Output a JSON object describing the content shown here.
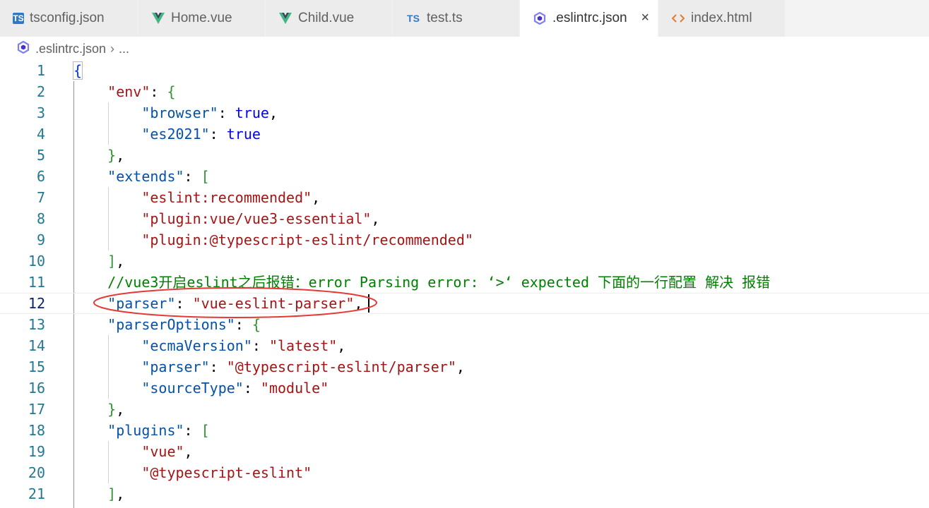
{
  "tabs": [
    {
      "label": "tsconfig.json",
      "icon": "typescript-icon",
      "active": false
    },
    {
      "label": "Home.vue",
      "icon": "vue-icon",
      "active": false
    },
    {
      "label": "Child.vue",
      "icon": "vue-icon",
      "active": false
    },
    {
      "label": "test.ts",
      "icon": "typescript-icon",
      "active": false
    },
    {
      "label": ".eslintrc.json",
      "icon": "eslint-icon",
      "active": true
    },
    {
      "label": "index.html",
      "icon": "html-icon",
      "active": false
    }
  ],
  "tab_icons": {
    "ts": "TS",
    "close": "×"
  },
  "breadcrumb": {
    "file": ".eslintrc.json",
    "separator": "›",
    "more": "..."
  },
  "colors": {
    "line_number": "#237893",
    "key": "#a31515",
    "string": "#a31515",
    "keyword": "#0000ff",
    "comment": "#008000",
    "annotation": "#e53935"
  },
  "editor": {
    "current_line": 12,
    "lines": [
      {
        "n": "1",
        "tokens": [
          [
            "br1",
            "{"
          ]
        ]
      },
      {
        "n": "2",
        "tokens": [
          [
            "sp",
            "    "
          ],
          [
            "k",
            "\"env\""
          ],
          [
            "p",
            ": "
          ],
          [
            "br2",
            "{"
          ]
        ]
      },
      {
        "n": "3",
        "tokens": [
          [
            "sp",
            "        "
          ],
          [
            "kn",
            "\"browser\""
          ],
          [
            "p",
            ": "
          ],
          [
            "b",
            "true"
          ],
          [
            "p",
            ","
          ]
        ]
      },
      {
        "n": "4",
        "tokens": [
          [
            "sp",
            "        "
          ],
          [
            "kn",
            "\"es2021\""
          ],
          [
            "p",
            ": "
          ],
          [
            "b",
            "true"
          ]
        ]
      },
      {
        "n": "5",
        "tokens": [
          [
            "sp",
            "    "
          ],
          [
            "br2",
            "}"
          ],
          [
            "p",
            ","
          ]
        ]
      },
      {
        "n": "6",
        "tokens": [
          [
            "sp",
            "    "
          ],
          [
            "kn",
            "\"extends\""
          ],
          [
            "p",
            ": "
          ],
          [
            "br2",
            "["
          ]
        ]
      },
      {
        "n": "7",
        "tokens": [
          [
            "sp",
            "        "
          ],
          [
            "s",
            "\"eslint:recommended\""
          ],
          [
            "p",
            ","
          ]
        ]
      },
      {
        "n": "8",
        "tokens": [
          [
            "sp",
            "        "
          ],
          [
            "s",
            "\"plugin:vue/vue3-essential\""
          ],
          [
            "p",
            ","
          ]
        ]
      },
      {
        "n": "9",
        "tokens": [
          [
            "sp",
            "        "
          ],
          [
            "s",
            "\"plugin:@typescript-eslint/recommended\""
          ]
        ]
      },
      {
        "n": "10",
        "tokens": [
          [
            "sp",
            "    "
          ],
          [
            "br2",
            "]"
          ],
          [
            "p",
            ","
          ]
        ]
      },
      {
        "n": "11",
        "tokens": [
          [
            "sp",
            "    "
          ],
          [
            "c",
            "//vue3开启eslint之后报错：error Parsing error: ‘>‘ expected 下面的一行配置 解决 报错"
          ]
        ]
      },
      {
        "n": "12",
        "tokens": [
          [
            "sp",
            "    "
          ],
          [
            "kn",
            "\"parser\""
          ],
          [
            "p",
            ": "
          ],
          [
            "s",
            "\"vue-eslint-parser\""
          ],
          [
            "p",
            ","
          ]
        ]
      },
      {
        "n": "13",
        "tokens": [
          [
            "sp",
            "    "
          ],
          [
            "kn",
            "\"parserOptions\""
          ],
          [
            "p",
            ": "
          ],
          [
            "br2",
            "{"
          ]
        ]
      },
      {
        "n": "14",
        "tokens": [
          [
            "sp",
            "        "
          ],
          [
            "kn",
            "\"ecmaVersion\""
          ],
          [
            "p",
            ": "
          ],
          [
            "s",
            "\"latest\""
          ],
          [
            "p",
            ","
          ]
        ]
      },
      {
        "n": "15",
        "tokens": [
          [
            "sp",
            "        "
          ],
          [
            "kn",
            "\"parser\""
          ],
          [
            "p",
            ": "
          ],
          [
            "s",
            "\"@typescript-eslint/parser\""
          ],
          [
            "p",
            ","
          ]
        ]
      },
      {
        "n": "16",
        "tokens": [
          [
            "sp",
            "        "
          ],
          [
            "kn",
            "\"sourceType\""
          ],
          [
            "p",
            ": "
          ],
          [
            "s",
            "\"module\""
          ]
        ]
      },
      {
        "n": "17",
        "tokens": [
          [
            "sp",
            "    "
          ],
          [
            "br2",
            "}"
          ],
          [
            "p",
            ","
          ]
        ]
      },
      {
        "n": "18",
        "tokens": [
          [
            "sp",
            "    "
          ],
          [
            "kn",
            "\"plugins\""
          ],
          [
            "p",
            ": "
          ],
          [
            "br2",
            "["
          ]
        ]
      },
      {
        "n": "19",
        "tokens": [
          [
            "sp",
            "        "
          ],
          [
            "s",
            "\"vue\""
          ],
          [
            "p",
            ","
          ]
        ]
      },
      {
        "n": "20",
        "tokens": [
          [
            "sp",
            "        "
          ],
          [
            "s",
            "\"@typescript-eslint\""
          ]
        ]
      },
      {
        "n": "21",
        "tokens": [
          [
            "sp",
            "    "
          ],
          [
            "br2",
            "]"
          ],
          [
            "p",
            ","
          ]
        ]
      }
    ]
  }
}
